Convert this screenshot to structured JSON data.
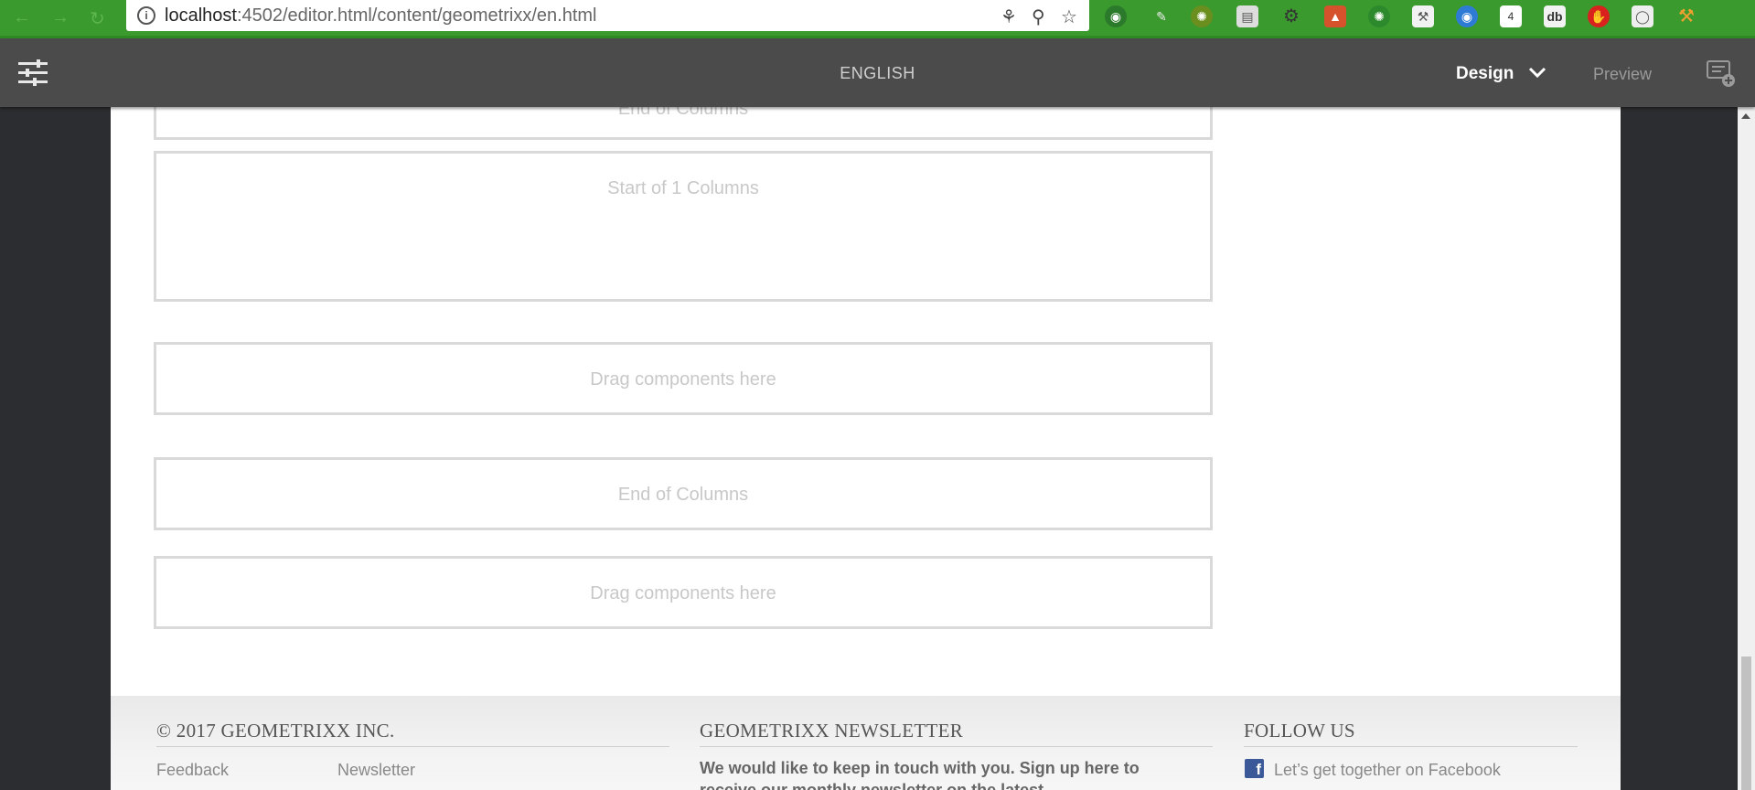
{
  "browser": {
    "url_host": "localhost",
    "url_path": ":4502/editor.html/content/geometrixx/en.html"
  },
  "editor": {
    "page_title": "ENGLISH",
    "mode": "Design",
    "preview_label": "Preview"
  },
  "canvas": {
    "partial_top_label": "End of Columns",
    "start_columns_label": "Start of 1 Columns",
    "drop_zone_1": "Drag components here",
    "end_columns_label": "End of Columns",
    "drop_zone_2": "Drag components here"
  },
  "footer": {
    "copyright": "© 2017 GEOMETRIXX INC.",
    "links": [
      "Feedback",
      "Newsletter"
    ],
    "newsletter_title": "GEOMETRIXX NEWSLETTER",
    "newsletter_text": "We would like to keep in touch with you. Sign up here to receive our monthly newsletter on the latest",
    "follow_title": "FOLLOW US",
    "facebook_text": "Let’s get together on Facebook"
  }
}
